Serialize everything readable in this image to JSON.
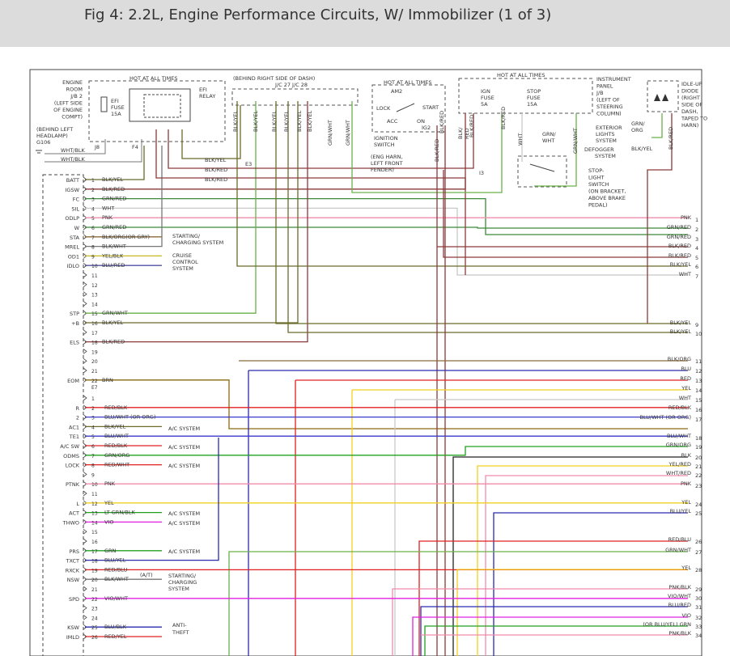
{
  "title": "Fig 4: 2.2L, Engine Performance Circuits, W/ Immobilizer (1 of 3)",
  "top_labels": [
    {
      "id": "hot1",
      "text": "HOT AT ALL TIMES"
    },
    {
      "id": "erjb1",
      "text": "ENGINE"
    },
    {
      "id": "erjb2",
      "text": "ROOM"
    },
    {
      "id": "erjb3",
      "text": "J/B 2"
    },
    {
      "id": "erjb4",
      "text": "(LEFT SIDE"
    },
    {
      "id": "erjb5",
      "text": "OF ENGINE"
    },
    {
      "id": "erjb6",
      "text": "COMPT)"
    },
    {
      "id": "efi1",
      "text": "EFI"
    },
    {
      "id": "efi2",
      "text": "FUSE"
    },
    {
      "id": "efi3",
      "text": "15A"
    },
    {
      "id": "efir1",
      "text": "EFI"
    },
    {
      "id": "efir2",
      "text": "RELAY"
    },
    {
      "id": "bhl1",
      "text": "(BEHIND LEFT"
    },
    {
      "id": "bhl2",
      "text": "HEADLAMP)"
    },
    {
      "id": "g106",
      "text": "G106"
    },
    {
      "id": "wb1",
      "text": "WHT/BLK"
    },
    {
      "id": "wb2",
      "text": "WHT/BLK"
    },
    {
      "id": "j8",
      "text": "J8"
    },
    {
      "id": "f4",
      "text": "F4"
    },
    {
      "id": "brsd",
      "text": "(BEHIND RIGHT SIDE OF DASH)"
    },
    {
      "id": "jc",
      "text": "J/C 27   J/C 28"
    },
    {
      "id": "hot2",
      "text": "HOT AT ALL TIMES"
    },
    {
      "id": "am2",
      "text": "AM2"
    },
    {
      "id": "lock",
      "text": "LOCK"
    },
    {
      "id": "start",
      "text": "START"
    },
    {
      "id": "acc",
      "text": "ACC"
    },
    {
      "id": "on",
      "text": "ON"
    },
    {
      "id": "ig2",
      "text": "IG2"
    },
    {
      "id": "ign1",
      "text": "IGNITION"
    },
    {
      "id": "ign2",
      "text": "SWITCH"
    },
    {
      "id": "hot3",
      "text": "HOT AT ALL TIMES"
    },
    {
      "id": "ignf1",
      "text": "IGN"
    },
    {
      "id": "ignf2",
      "text": "FUSE"
    },
    {
      "id": "ignf3",
      "text": "5A"
    },
    {
      "id": "stopf1",
      "text": "STOP"
    },
    {
      "id": "stopf2",
      "text": "FUSE"
    },
    {
      "id": "stopf3",
      "text": "15A"
    },
    {
      "id": "ipjb1",
      "text": "INSTRUMENT"
    },
    {
      "id": "ipjb2",
      "text": "PANEL"
    },
    {
      "id": "ipjb3",
      "text": "J/B"
    },
    {
      "id": "ipjb4",
      "text": "(LEFT OF"
    },
    {
      "id": "ipjb5",
      "text": "STEERING"
    },
    {
      "id": "ipjb6",
      "text": "COLUMN)"
    },
    {
      "id": "idle1",
      "text": "IDLE-UP"
    },
    {
      "id": "idle2",
      "text": "DIODE"
    },
    {
      "id": "idle3",
      "text": "(RIGHT"
    },
    {
      "id": "idle4",
      "text": "SIDE OF"
    },
    {
      "id": "idle5",
      "text": "DASH,"
    },
    {
      "id": "idle6",
      "text": "TAPED TO"
    },
    {
      "id": "idle7",
      "text": "HARN)"
    },
    {
      "id": "grnorg1",
      "text": "GRN/"
    },
    {
      "id": "grnorg2",
      "text": "ORG"
    },
    {
      "id": "ext1",
      "text": "EXTERIOR"
    },
    {
      "id": "ext2",
      "text": "LIGHTS"
    },
    {
      "id": "ext3",
      "text": "SYSTEM"
    },
    {
      "id": "grnwht1",
      "text": "GRN/"
    },
    {
      "id": "grnwht2",
      "text": "WHT"
    },
    {
      "id": "def1",
      "text": "DEFOGGER"
    },
    {
      "id": "def2",
      "text": "SYSTEM"
    },
    {
      "id": "blkyel",
      "text": "BLK/YEL"
    },
    {
      "id": "e3",
      "text": "E3"
    },
    {
      "id": "blkyel2",
      "text": "BLK/YEL"
    },
    {
      "id": "blkred2",
      "text": "BLK/RED"
    },
    {
      "id": "blkred3",
      "text": "BLK/RED"
    },
    {
      "id": "eng1",
      "text": "(ENG HARN,"
    },
    {
      "id": "eng2",
      "text": "LEFT FRONT"
    },
    {
      "id": "eng3",
      "text": "FENDER)"
    },
    {
      "id": "i3",
      "text": "I3"
    },
    {
      "id": "sls1",
      "text": "STOP-"
    },
    {
      "id": "sls2",
      "text": "LIGHT"
    },
    {
      "id": "sls3",
      "text": "SWITCH"
    },
    {
      "id": "sls4",
      "text": "(ON BRACKET,"
    },
    {
      "id": "sls5",
      "text": "ABOVE BRAKE"
    },
    {
      "id": "sls6",
      "text": "PEDAL)"
    },
    {
      "id": "e7",
      "text": "E7"
    }
  ],
  "vert_labels": [
    {
      "id": "v1",
      "text": "BLK/YEL"
    },
    {
      "id": "v2",
      "text": "BLK/YEL"
    },
    {
      "id": "v3",
      "text": "BLK/YEL"
    },
    {
      "id": "v4",
      "text": "BLK/YEL"
    },
    {
      "id": "v5",
      "text": "BLK/YEL"
    },
    {
      "id": "v6",
      "text": "BLK/YEL"
    },
    {
      "id": "v7",
      "text": "GRN/WHT"
    },
    {
      "id": "v8",
      "text": "GRN/WHT"
    },
    {
      "id": "v9",
      "text": "BLK/RED"
    },
    {
      "id": "v10",
      "text": "BLK/RED"
    },
    {
      "id": "v11",
      "text": "BLK/RED"
    },
    {
      "id": "v12",
      "text": "BLK/RED"
    },
    {
      "id": "v13",
      "text": "BLK/"
    },
    {
      "id": "v13b",
      "text": "RED"
    },
    {
      "id": "v14",
      "text": "WHT"
    },
    {
      "id": "v15",
      "text": "GRN/WHT"
    },
    {
      "id": "v16",
      "text": "BLK/RED"
    }
  ],
  "ecm_pins_upper": [
    {
      "name": "BATT",
      "num": "1",
      "wire": "BLK/YEL"
    },
    {
      "name": "IGSW",
      "num": "2",
      "wire": "BLK/RED"
    },
    {
      "name": "FC",
      "num": "3",
      "wire": "GRN/RED"
    },
    {
      "name": "SIL",
      "num": "4",
      "wire": "WHT"
    },
    {
      "name": "ODLP",
      "num": "5",
      "wire": "PNK"
    },
    {
      "name": "W",
      "num": "6",
      "wire": "GRN/RED"
    },
    {
      "name": "STA",
      "num": "7",
      "wire": "BLK/ORG(OR GRY)"
    },
    {
      "name": "MREL",
      "num": "8",
      "wire": "BLK/WHT"
    },
    {
      "name": "OD1",
      "num": "9",
      "wire": "YEL/BLK"
    },
    {
      "name": "IDLO",
      "num": "10",
      "wire": "BLU/RED"
    },
    {
      "name": "",
      "num": "11",
      "wire": ""
    },
    {
      "name": "",
      "num": "12",
      "wire": ""
    },
    {
      "name": "",
      "num": "13",
      "wire": ""
    },
    {
      "name": "",
      "num": "14",
      "wire": ""
    },
    {
      "name": "STP",
      "num": "15",
      "wire": "GRN/WHT"
    },
    {
      "name": "+B",
      "num": "16",
      "wire": "BLK/YEL"
    },
    {
      "name": "",
      "num": "17",
      "wire": ""
    },
    {
      "name": "ELS",
      "num": "18",
      "wire": "BLK/RED"
    },
    {
      "name": "",
      "num": "19",
      "wire": ""
    },
    {
      "name": "",
      "num": "20",
      "wire": ""
    },
    {
      "name": "",
      "num": "21",
      "wire": ""
    },
    {
      "name": "EOM",
      "num": "22",
      "wire": "BRN"
    }
  ],
  "ecm_pins_lower": [
    {
      "name": "",
      "num": "1",
      "wire": ""
    },
    {
      "name": "R",
      "num": "2",
      "wire": "RED/BLK"
    },
    {
      "name": "2",
      "num": "3",
      "wire": "BLU/WHT (OR ORG)"
    },
    {
      "name": "AC1",
      "num": "4",
      "wire": "BLK/YEL"
    },
    {
      "name": "TE1",
      "num": "5",
      "wire": "BLU/WHT"
    },
    {
      "name": "A/C SW",
      "num": "6",
      "wire": "RED/BLK"
    },
    {
      "name": "ODMS",
      "num": "7",
      "wire": "GRN/ORG"
    },
    {
      "name": "LOCK",
      "num": "8",
      "wire": "RED/WHT"
    },
    {
      "name": "",
      "num": "9",
      "wire": ""
    },
    {
      "name": "PTNK",
      "num": "10",
      "wire": "PNK"
    },
    {
      "name": "",
      "num": "11",
      "wire": ""
    },
    {
      "name": "L",
      "num": "12",
      "wire": "YEL"
    },
    {
      "name": "ACT",
      "num": "13",
      "wire": "LT GRN/BLK"
    },
    {
      "name": "THWO",
      "num": "14",
      "wire": "VIO"
    },
    {
      "name": "",
      "num": "15",
      "wire": ""
    },
    {
      "name": "",
      "num": "16",
      "wire": ""
    },
    {
      "name": "PRS",
      "num": "17",
      "wire": "GRN"
    },
    {
      "name": "TXCT",
      "num": "18",
      "wire": "BLU/YEL"
    },
    {
      "name": "RXCK",
      "num": "19",
      "wire": "RED/BLU"
    },
    {
      "name": "NSW",
      "num": "20",
      "wire": "BLK/WHT"
    },
    {
      "name": "",
      "num": "21",
      "wire": ""
    },
    {
      "name": "SPD",
      "num": "22",
      "wire": "VIO/WHT"
    },
    {
      "name": "",
      "num": "23",
      "wire": ""
    },
    {
      "name": "",
      "num": "24",
      "wire": ""
    },
    {
      "name": "KSW",
      "num": "25",
      "wire": "BLU/BLK"
    },
    {
      "name": "IMLD",
      "num": "26",
      "wire": "RED/YEL"
    }
  ],
  "side_labels": [
    {
      "id": "sc1",
      "text": "STARTING/"
    },
    {
      "id": "sc2",
      "text": "CHARGING SYSTEM"
    },
    {
      "id": "cc1",
      "text": "CRUISE"
    },
    {
      "id": "cc2",
      "text": "CONTROL"
    },
    {
      "id": "cc3",
      "text": "SYSTEM"
    },
    {
      "id": "ac1",
      "text": "A/C SYSTEM"
    },
    {
      "id": "ac2",
      "text": "A/C SYSTEM"
    },
    {
      "id": "ac3",
      "text": "A/C SYSTEM"
    },
    {
      "id": "ac4",
      "text": "A/C SYSTEM"
    },
    {
      "id": "ac5",
      "text": "A/C SYSTEM"
    },
    {
      "id": "ac6",
      "text": "A/C SYSTEM"
    },
    {
      "id": "at",
      "text": "(A/T)"
    },
    {
      "id": "sc3",
      "text": "STARTING/"
    },
    {
      "id": "sc4",
      "text": "CHARGING"
    },
    {
      "id": "sc5",
      "text": "SYSTEM"
    },
    {
      "id": "at1",
      "text": "ANTI-"
    },
    {
      "id": "at2",
      "text": "THEFT"
    }
  ],
  "right_labels": [
    {
      "wire": "PNK",
      "num": "1"
    },
    {
      "wire": "GRN/RED",
      "num": "2"
    },
    {
      "wire": "GRN/RED",
      "num": "3"
    },
    {
      "wire": "BLK/RED",
      "num": "4"
    },
    {
      "wire": "BLK/RED",
      "num": "5"
    },
    {
      "wire": "BLK/YEL",
      "num": "6"
    },
    {
      "wire": "WHT",
      "num": "7"
    },
    {
      "wire": "BLK/YEL",
      "num": "9"
    },
    {
      "wire": "BLK/YEL",
      "num": "10"
    },
    {
      "wire": "BLK/ORG",
      "num": "11"
    },
    {
      "wire": "BLU",
      "num": "12"
    },
    {
      "wire": "RED",
      "num": "13"
    },
    {
      "wire": "YEL",
      "num": "14"
    },
    {
      "wire": "WHT",
      "num": "15"
    },
    {
      "wire": "RED/BLK",
      "num": "16"
    },
    {
      "wire": "BLU/WHT (OR ORG)",
      "num": "17"
    },
    {
      "wire": "BLU/WHT",
      "num": "18"
    },
    {
      "wire": "GRN/ORG",
      "num": "19"
    },
    {
      "wire": "BLK",
      "num": "20"
    },
    {
      "wire": "YEL/RED",
      "num": "21"
    },
    {
      "wire": "WHT/RED",
      "num": "22"
    },
    {
      "wire": "PNK",
      "num": "23"
    },
    {
      "wire": "YEL",
      "num": "24"
    },
    {
      "wire": "BLU/YEL",
      "num": "25"
    },
    {
      "wire": "RED/BLU",
      "num": "26"
    },
    {
      "wire": "GRN/WHT",
      "num": "27"
    },
    {
      "wire": "YEL",
      "num": "28"
    },
    {
      "wire": "PNK/BLK",
      "num": "29"
    },
    {
      "wire": "VIO/WHT",
      "num": "30"
    },
    {
      "wire": "BLU/RED",
      "num": "31"
    },
    {
      "wire": "VIO",
      "num": "32"
    },
    {
      "wire": "(OR BLU/YEL)  GRN",
      "num": "33"
    },
    {
      "wire": "PNK/BLK",
      "num": "34"
    }
  ],
  "colors": {
    "blk_yel": "#6b6b2a",
    "blk_red": "#8b3a3a",
    "grn_red": "#3a8a3a",
    "wht": "#c8c8c8",
    "pnk": "#f08caa",
    "yel": "#f0d020",
    "blu": "#2a2ab0",
    "red": "#e02020",
    "grn": "#20a020",
    "vio": "#e020e0",
    "brn": "#8a6a10",
    "blk_org": "#8a6a3a",
    "grn_wht": "#6ab04a",
    "blk_wht": "#777777",
    "yel_blk": "#c8b820",
    "blu_red": "#5050a0",
    "blu_wht": "#3a3acc"
  }
}
